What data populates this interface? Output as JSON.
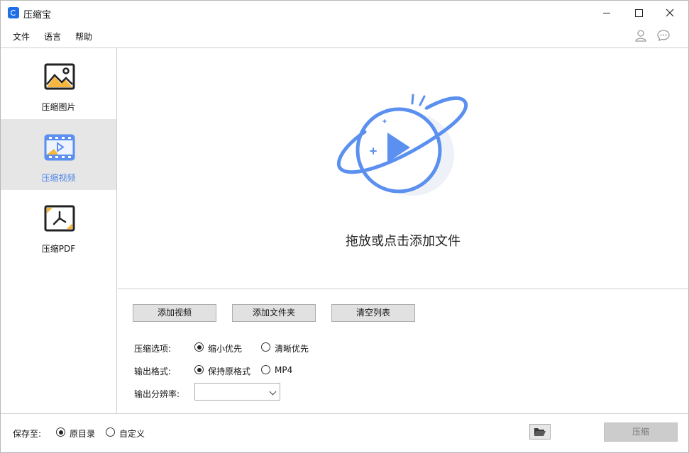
{
  "app": {
    "title": "压缩宝",
    "icon": "app-logo-icon",
    "accent_color": "#5b8ff0"
  },
  "window_controls": [
    "minimize-icon",
    "maximize-icon",
    "close-icon"
  ],
  "menu": {
    "file": "文件",
    "language": "语言",
    "help": "帮助"
  },
  "header_icons": [
    "user-icon",
    "chat-icon"
  ],
  "sidebar": {
    "items": [
      {
        "label": "压缩图片",
        "icon": "image-icon",
        "active": false
      },
      {
        "label": "压缩视频",
        "icon": "video-icon",
        "active": true
      },
      {
        "label": "压缩PDF",
        "icon": "pdf-icon",
        "active": false
      }
    ]
  },
  "drop_zone": {
    "text": "拖放或点击添加文件",
    "icon": "planet-play-icon"
  },
  "buttons": {
    "add_video": "添加视频",
    "add_folder": "添加文件夹",
    "clear_list": "清空列表"
  },
  "options": {
    "compress_label": "压缩选项:",
    "compress_choices": [
      {
        "label": "缩小优先",
        "checked": true
      },
      {
        "label": "清晰优先",
        "checked": false
      }
    ],
    "format_label": "输出格式:",
    "format_choices": [
      {
        "label": "保持原格式",
        "checked": true
      },
      {
        "label": "MP4",
        "checked": false
      }
    ],
    "resolution_label": "输出分辨率:",
    "resolution_value": ""
  },
  "footer": {
    "save_to_label": "保存至:",
    "save_choices": [
      {
        "label": "原目录",
        "checked": true
      },
      {
        "label": "自定义",
        "checked": false
      }
    ],
    "folder_icon": "folder-open-icon",
    "compress_button": "压缩"
  }
}
